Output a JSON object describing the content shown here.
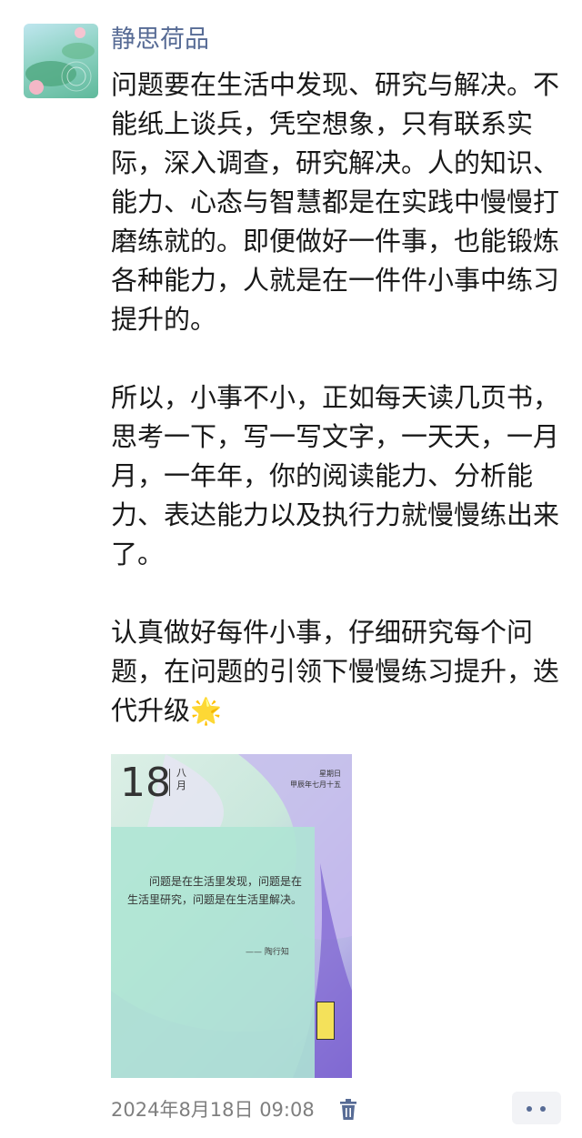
{
  "post": {
    "author": "静思荷品",
    "paragraphs": [
      "问题要在生活中发现、研究与解决。不能纸上谈兵，凭空想象，只有联系实际，深入调查，研究解决。人的知识、能力、心态与智慧都是在实践中慢慢打磨练就的。即便做好一件事，也能锻炼各种能力，人就是在一件件小事中练习提升的。",
      "所以，小事不小，正如每天读几页书，思考一下，写一写文字，一天天，一月月，一年年，你的阅读能力、分析能力、表达能力以及执行力就慢慢练出来了。",
      "认真做好每件小事，仔细研究每个问题，在问题的引领下慢慢练习提升，迭代升级"
    ],
    "emoji": "🌟",
    "timestamp": "2024年8月18日 09:08"
  },
  "image": {
    "day": "18",
    "month": "八月",
    "weekday": "星期日",
    "lunar": "甲辰年七月十五",
    "quote": "问题是在生活里发现，问题是在生活里研究，问题是在生活里解决。",
    "author": "—— 陶行知"
  },
  "colors": {
    "link": "#576b95",
    "text": "#191919",
    "meta": "#7f7f7f"
  },
  "icons": {
    "delete": "trash-icon",
    "more": "more-dots-icon"
  }
}
